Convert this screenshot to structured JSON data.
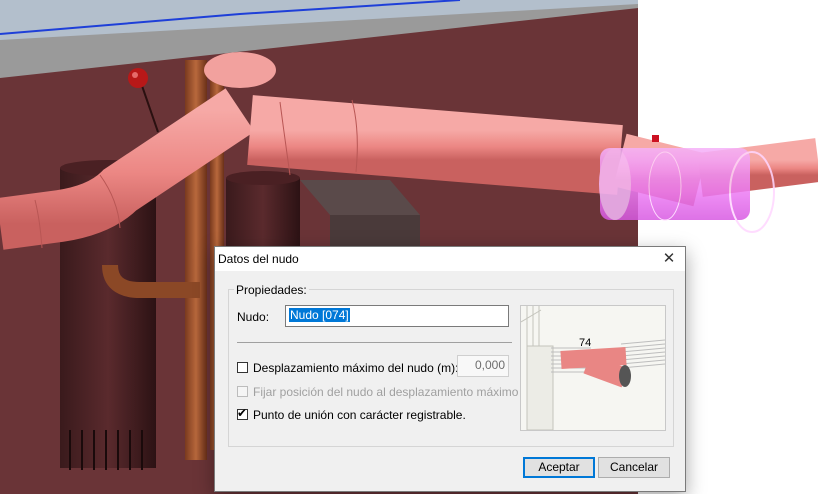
{
  "dialog": {
    "title": "Datos del nudo",
    "group_title": "Propiedades:",
    "node_label": "Nudo:",
    "node_value": "Nudo [074]",
    "max_disp": {
      "label": "Desplazamiento máximo del nudo (m):",
      "checked": false,
      "value": "0,000"
    },
    "fix_position": {
      "label": "Fijar posición del nudo al desplazamiento máximo",
      "checked": false,
      "enabled": false
    },
    "union_point": {
      "label": "Punto de unión con carácter registrable.",
      "checked": true
    },
    "preview_node_number": "74",
    "ok_label": "Aceptar",
    "cancel_label": "Cancelar"
  },
  "colors": {
    "pipe": "#ef8f8c",
    "highlight": "#ee7df5",
    "wall": "#6a3437",
    "accent": "#0078d7"
  }
}
